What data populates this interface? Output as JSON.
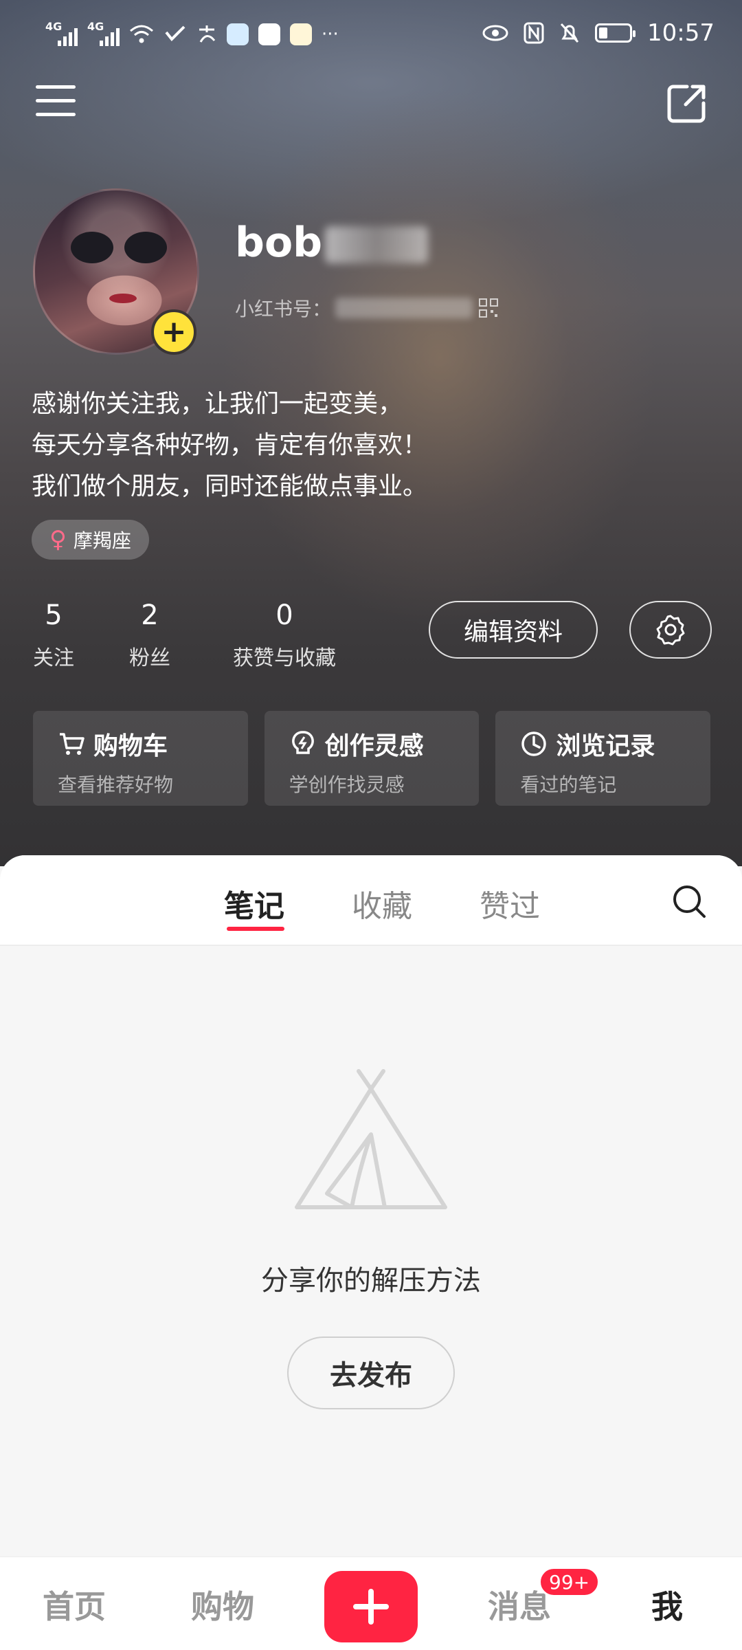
{
  "status_bar": {
    "time": "10:57",
    "network_1": "4G",
    "network_2": "4G",
    "more": "···"
  },
  "profile": {
    "username_visible": "bob",
    "redbook_id_label": "小红书号：",
    "bio_lines": [
      "感谢你关注我，让我们一起变美，",
      "每天分享各种好物，肯定有你喜欢！",
      "我们做个朋友，同时还能做点事业。"
    ],
    "tag": "摩羯座",
    "stats": [
      {
        "count": "5",
        "label": "关注"
      },
      {
        "count": "2",
        "label": "粉丝"
      },
      {
        "count": "0",
        "label": "获赞与收藏"
      }
    ],
    "edit_label": "编辑资料"
  },
  "quick_cards": [
    {
      "title": "购物车",
      "subtitle": "查看推荐好物",
      "icon": "cart-icon"
    },
    {
      "title": "创作灵感",
      "subtitle": "学创作找灵感",
      "icon": "bulb-icon"
    },
    {
      "title": "浏览记录",
      "subtitle": "看过的笔记",
      "icon": "clock-icon"
    }
  ],
  "tabs": [
    {
      "label": "笔记",
      "active": true
    },
    {
      "label": "收藏",
      "active": false
    },
    {
      "label": "赞过",
      "active": false
    }
  ],
  "empty_state": {
    "text": "分享你的解压方法",
    "button": "去发布"
  },
  "bottom_nav": {
    "home": "首页",
    "shop": "购物",
    "messages": "消息",
    "message_badge": "99+",
    "me": "我"
  },
  "colors": {
    "accent": "#ff2442",
    "avatar_add": "#ffe23b"
  }
}
